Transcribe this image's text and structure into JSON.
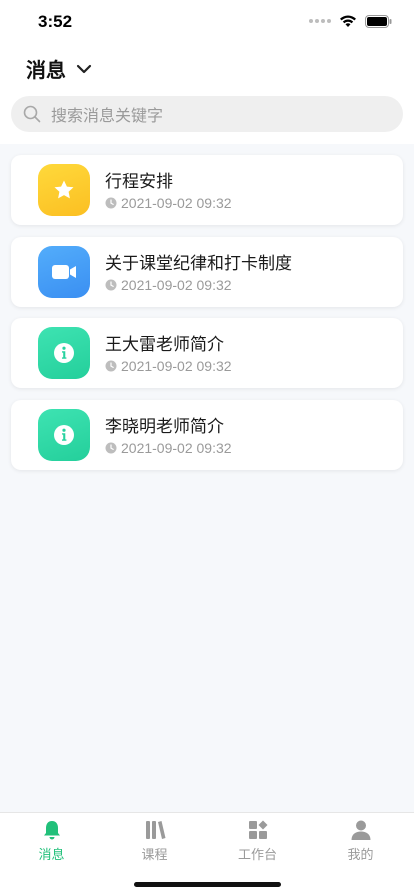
{
  "status_bar": {
    "time": "3:52"
  },
  "header": {
    "title": "消息"
  },
  "search": {
    "placeholder": "搜索消息关键字"
  },
  "messages": [
    {
      "title": "行程安排",
      "time": "2021-09-02 09:32",
      "icon": "star-icon",
      "color": "#fcc72d"
    },
    {
      "title": "关于课堂纪律和打卡制度",
      "time": "2021-09-02 09:32",
      "icon": "video-icon",
      "color": "#3f9df7"
    },
    {
      "title": "王大雷老师简介",
      "time": "2021-09-02 09:32",
      "icon": "info-icon",
      "color": "#2fd8a6"
    },
    {
      "title": "李晓明老师简介",
      "time": "2021-09-02 09:32",
      "icon": "info-icon",
      "color": "#2fd8a6"
    }
  ],
  "tabbar": {
    "active_color": "#21c07a",
    "items": [
      {
        "label": "消息",
        "icon": "bell-icon",
        "active": true
      },
      {
        "label": "课程",
        "icon": "books-icon",
        "active": false
      },
      {
        "label": "工作台",
        "icon": "workbench-icon",
        "active": false
      },
      {
        "label": "我的",
        "icon": "user-icon",
        "active": false
      }
    ]
  }
}
